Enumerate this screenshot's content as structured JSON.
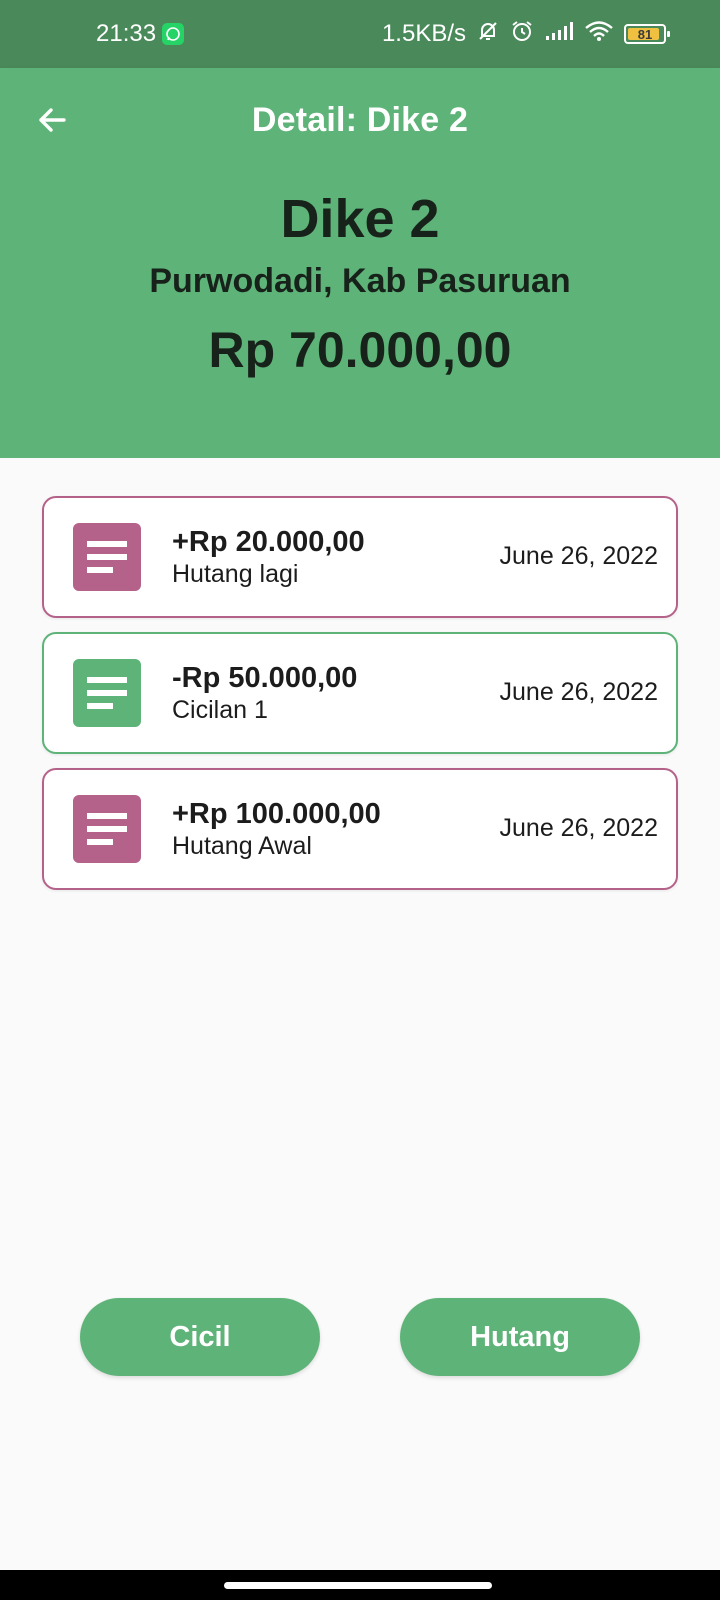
{
  "status_bar": {
    "time": "21:33",
    "network_speed": "1.5KB/s",
    "battery_level": "81",
    "icons": [
      "whatsapp-icon",
      "mute-bell-icon",
      "alarm-icon",
      "signal-icon",
      "wifi-icon",
      "battery-icon"
    ]
  },
  "app_bar": {
    "title": "Detail: Dike 2",
    "back_icon": "arrow-left-icon"
  },
  "header": {
    "name": "Dike 2",
    "address": "Purwodadi, Kab Pasuruan",
    "balance": "Rp 70.000,00"
  },
  "transactions": [
    {
      "amount": "+Rp 20.000,00",
      "note": "Hutang lagi",
      "date": "June 26, 2022",
      "type": "hutang",
      "color": "#b5628a"
    },
    {
      "amount": "-Rp 50.000,00",
      "note": "Cicilan 1",
      "date": "June 26, 2022",
      "type": "cicil",
      "color": "#5eb378"
    },
    {
      "amount": "+Rp 100.000,00",
      "note": "Hutang Awal",
      "date": "June 26, 2022",
      "type": "hutang",
      "color": "#b5628a"
    }
  ],
  "actions": {
    "cicil_label": "Cicil",
    "hutang_label": "Hutang"
  },
  "colors": {
    "primary": "#5eb378",
    "status_bar": "#4a8a5a",
    "debt_accent": "#b5628a",
    "background": "#fafafa"
  }
}
